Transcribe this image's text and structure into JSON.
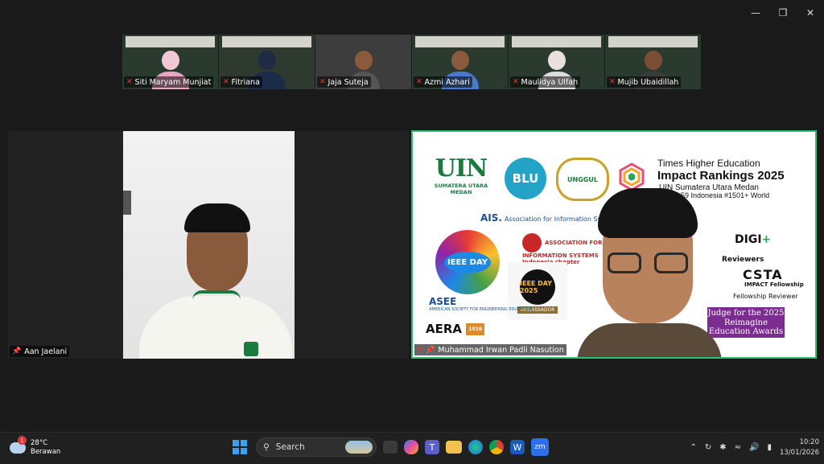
{
  "window": {
    "minimize_icon": "minimize-icon",
    "restore_icon": "restore-icon",
    "close_icon": "close-icon"
  },
  "participants_strip": [
    {
      "name": "Siti Maryam Munjiat",
      "muted": true
    },
    {
      "name": "Fitriana",
      "muted": true
    },
    {
      "name": "Jaja Suteja",
      "muted": true
    },
    {
      "name": "Azmi Azhari",
      "muted": true
    },
    {
      "name": "Maulidya Ulfah",
      "muted": true
    },
    {
      "name": "Mujib Ubaidillah",
      "muted": true
    }
  ],
  "main_left": {
    "name": "Aan Jaelani",
    "pinned": true
  },
  "main_right": {
    "name": "Muhammad Irwan Padli Nasution",
    "pinned": true,
    "muted": true,
    "slide": {
      "uin_logo": "UIN",
      "uin_caption": "SUMATERA UTARA MEDAN",
      "blu": "BLU",
      "unggul": "UNGGUL",
      "the_title": "Times Higher Education",
      "the_sub": "Impact Rankings 2025",
      "the_sub2": "UIN Sumatera Utara Medan",
      "the_sub3": "#59 Indonesia  #1501+ World",
      "ais": "Association for Information Systems",
      "ais_short": "AIS.",
      "ieee": "IEEE DAY",
      "aisindo": "ASSOCIATION FOR INFORMATION SYSTEMS Indonesia chapter (AISINDO)",
      "ambassador_badge": "IEEE DAY 2025",
      "ambassador": "AMBASSADOR",
      "asee": "ASEE",
      "asee_sub": "AMERICAN SOCIETY FOR ENGINEERING EDUCATION",
      "aera": "AERA",
      "aera_year": "1916",
      "digi": "DIGI",
      "reviewers": "Reviewers",
      "csta": "CSTA",
      "impact_fellowship": "IMPACT Fellowship",
      "fellowship_reviewer": "Fellowship Reviewer",
      "judge": "Judge for the 2025 Reimagine Education Awards"
    }
  },
  "taskbar": {
    "weather_temp": "28°C",
    "weather_desc": "Berawan",
    "weather_badge": "1",
    "search_placeholder": "Search",
    "time": "10:20",
    "date": "13/01/2026",
    "zoom_label": "zm"
  }
}
